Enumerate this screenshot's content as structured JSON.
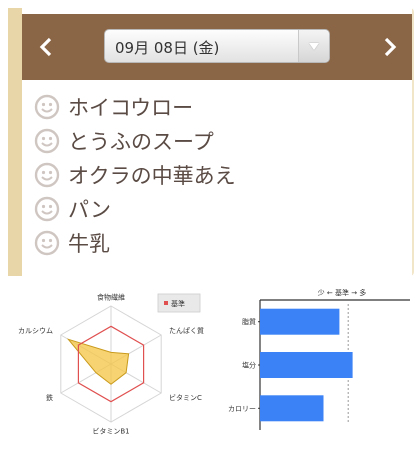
{
  "header": {
    "date": "09月 08日 (金)"
  },
  "menu": {
    "items": [
      "ホイコウロー",
      "とうふのスープ",
      "オクラの中華あえ",
      "パン",
      "牛乳"
    ]
  },
  "colors": {
    "header_bg": "#8b6646",
    "frame": "#f2e6c9",
    "text": "#5b4b45",
    "icon": "#cfc6c2",
    "radar_fill": "#f4c542",
    "bar": "#3b82f6",
    "standard_line": "#e05050"
  },
  "icons": {
    "prev": "chevron-left-icon",
    "next": "chevron-right-icon",
    "item": "smiley-icon",
    "dropdown": "caret-down-icon"
  },
  "chart_data": [
    {
      "type": "radar",
      "legend": "基準",
      "axes": [
        "食物繊維",
        "たんぱく質",
        "ビタミンC",
        "ビタミンB1",
        "鉄",
        "カルシウム"
      ],
      "values": [
        0.2,
        0.35,
        0.3,
        0.35,
        0.3,
        0.85
      ],
      "standard": [
        0.65,
        0.65,
        0.65,
        0.65,
        0.65,
        0.65
      ],
      "max": 1
    },
    {
      "type": "bar",
      "orientation": "horizontal",
      "title": "少 ← 基準 → 多",
      "categories": [
        "脂質",
        "塩分",
        "カロリー"
      ],
      "values": [
        0.9,
        1.05,
        0.72
      ],
      "standard": 1.0,
      "xlim": [
        0,
        1.7
      ]
    }
  ]
}
